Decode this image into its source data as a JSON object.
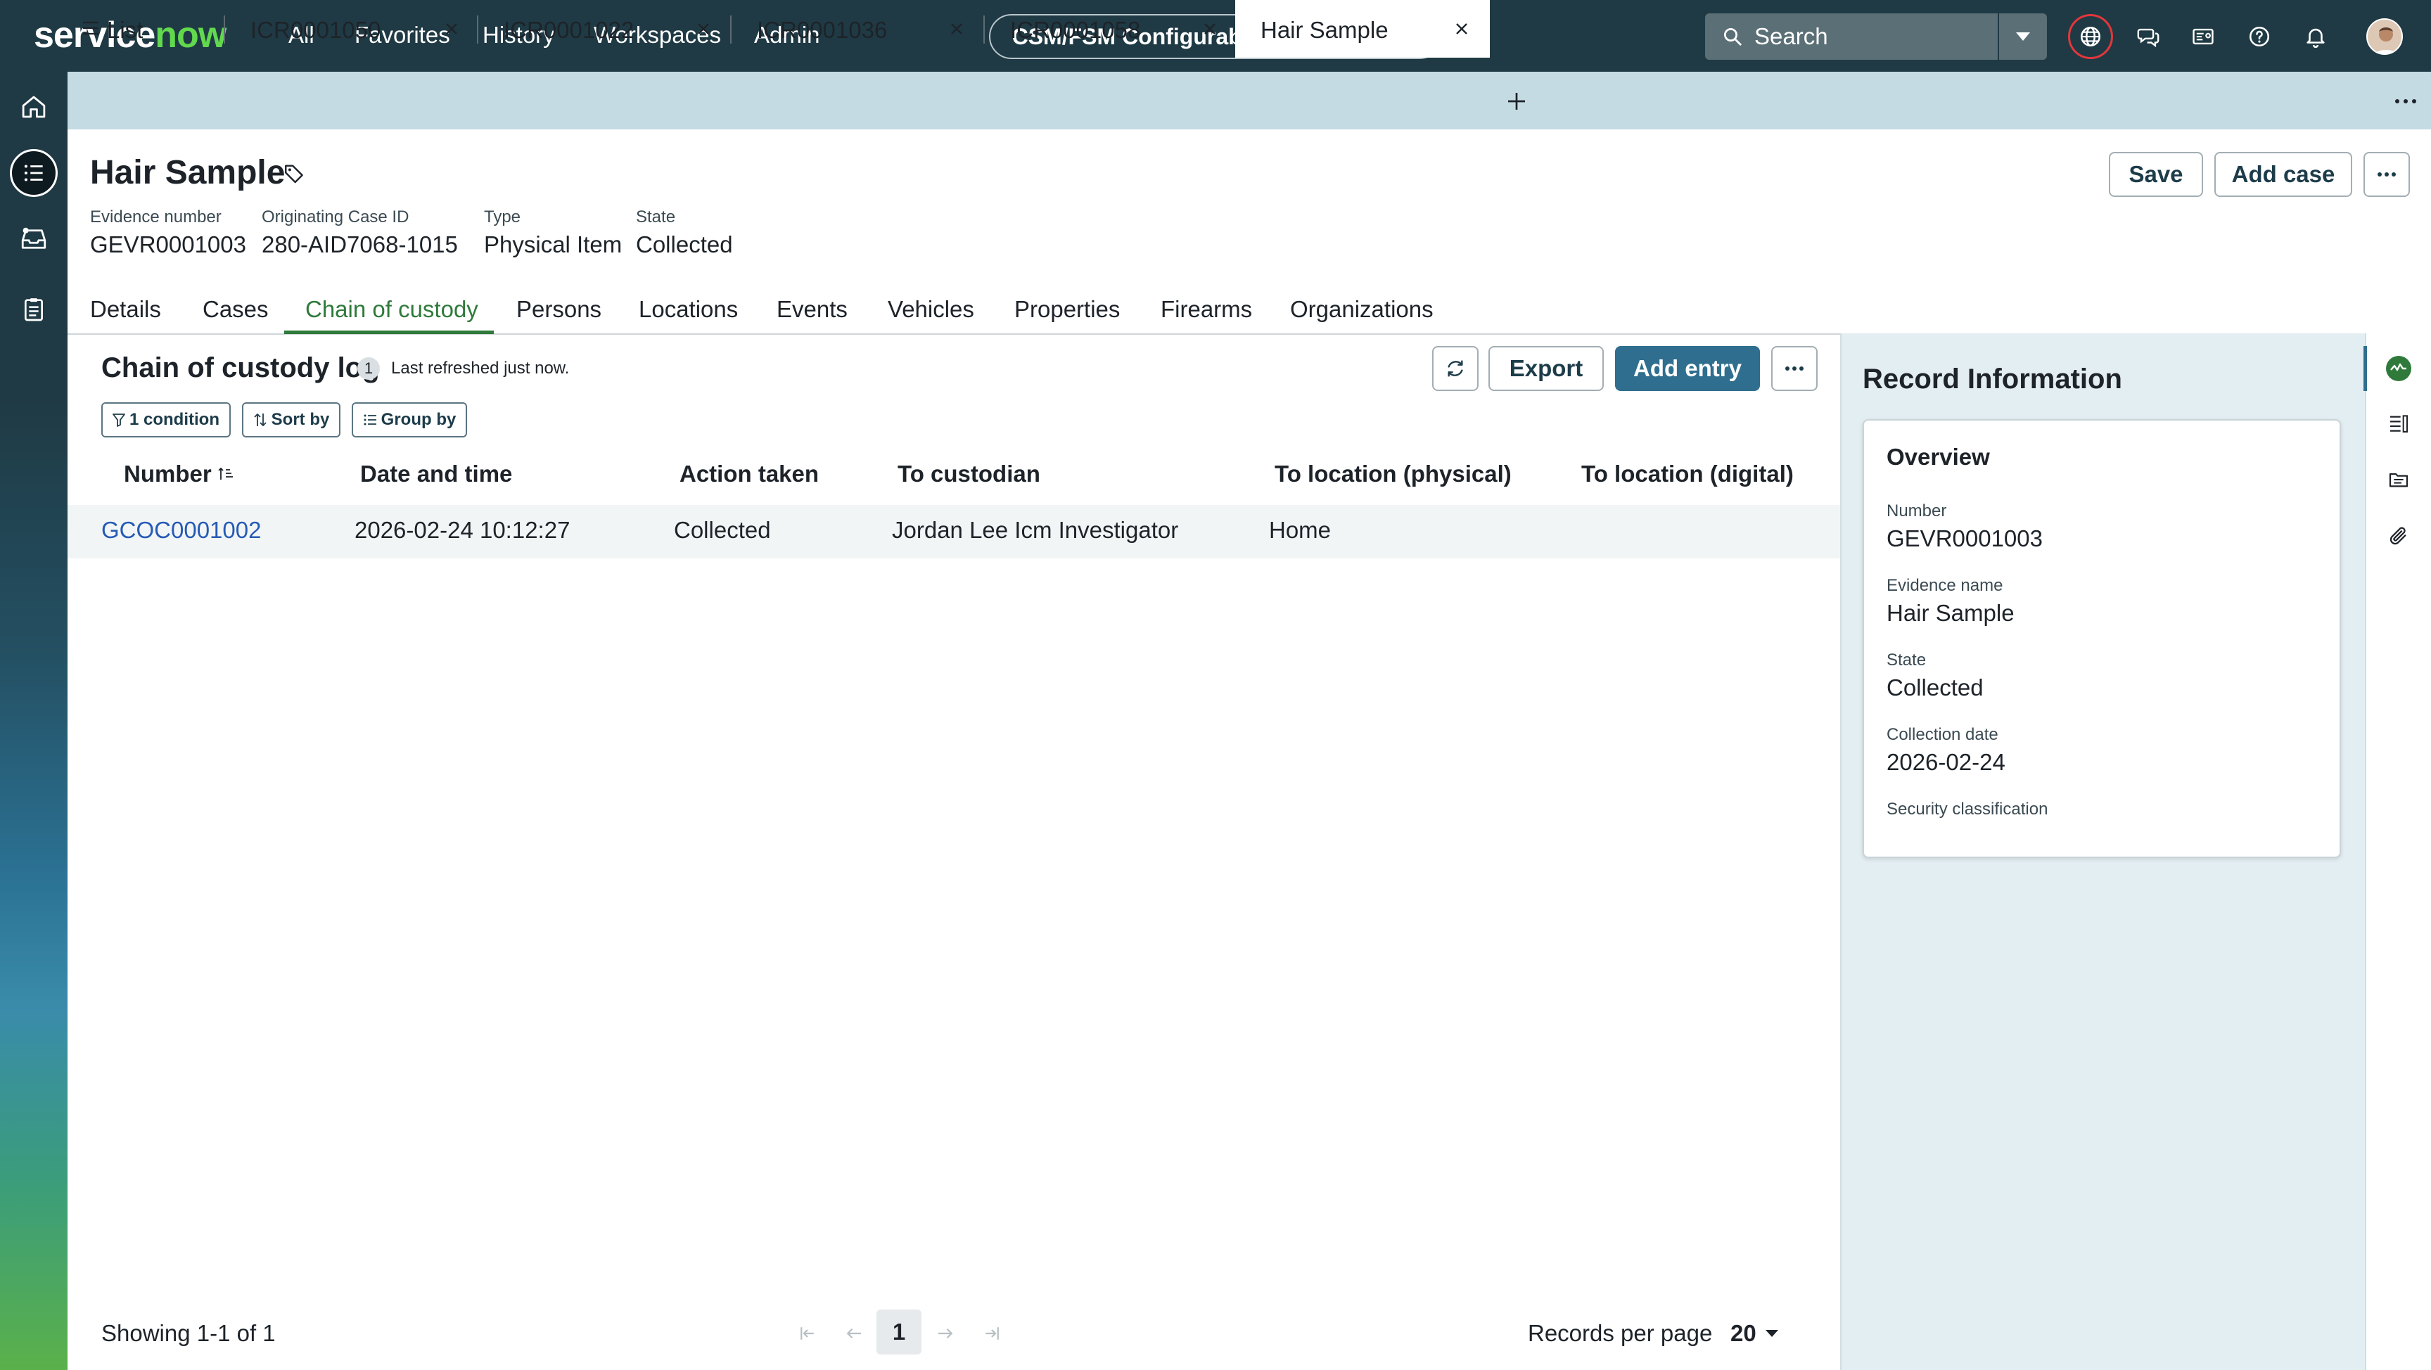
{
  "app": {
    "logo_text_a": "service",
    "logo_text_b": "now",
    "nav": [
      "All",
      "Favorites",
      "History",
      "Workspaces",
      "Admin"
    ],
    "workspace": "CSM/FSM Configurable Workspace",
    "search_placeholder": "Search"
  },
  "tabs": {
    "list_label": "List",
    "items": [
      "ICR0001050",
      "ICR0001022",
      "ICR0001036",
      "ICR0001058",
      "Hair Sample"
    ],
    "active": "Hair Sample"
  },
  "record": {
    "title": "Hair Sample",
    "save": "Save",
    "add_case": "Add case",
    "meta": [
      {
        "label": "Evidence number",
        "value": "GEVR0001003"
      },
      {
        "label": "Originating Case ID",
        "value": "280-AID7068-1015"
      },
      {
        "label": "Type",
        "value": "Physical Item"
      },
      {
        "label": "State",
        "value": "Collected"
      }
    ],
    "tabs": [
      "Details",
      "Cases",
      "Chain of custody",
      "Persons",
      "Locations",
      "Events",
      "Vehicles",
      "Properties",
      "Firearms",
      "Organizations"
    ],
    "active_tab": "Chain of custody"
  },
  "log": {
    "title": "Chain of custody log",
    "count": "1",
    "refreshed": "Last refreshed just now.",
    "export": "Export",
    "add_entry": "Add entry",
    "chips": {
      "condition": "1 condition",
      "sort": "Sort by",
      "group": "Group by"
    },
    "columns": [
      "Number",
      "Date and time",
      "Action taken",
      "To custodian",
      "To location (physical)",
      "To location (digital)"
    ],
    "rows": [
      {
        "number": "GCOC0001002",
        "datetime": "2026-02-24 10:12:27",
        "action": "Collected",
        "custodian": "Jordan Lee Icm Investigator",
        "loc_physical": "Home",
        "loc_digital": ""
      }
    ],
    "showing": "Showing 1-1 of 1",
    "current_page": "1",
    "rpp_label": "Records per page",
    "rpp_value": "20"
  },
  "panel": {
    "title": "Record Information",
    "overview": "Overview",
    "fields": [
      {
        "label": "Number",
        "value": "GEVR0001003"
      },
      {
        "label": "Evidence name",
        "value": "Hair Sample"
      },
      {
        "label": "State",
        "value": "Collected"
      },
      {
        "label": "Collection date",
        "value": "2026-02-24"
      },
      {
        "label": "Security classification",
        "value": ""
      }
    ]
  },
  "colors": {
    "nav_bg": "#1f3a44",
    "brand_green": "#62d84e",
    "accent_blue": "#2f6e8e",
    "active_tab_green": "#2f7a3b",
    "link_blue": "#265bb5"
  }
}
